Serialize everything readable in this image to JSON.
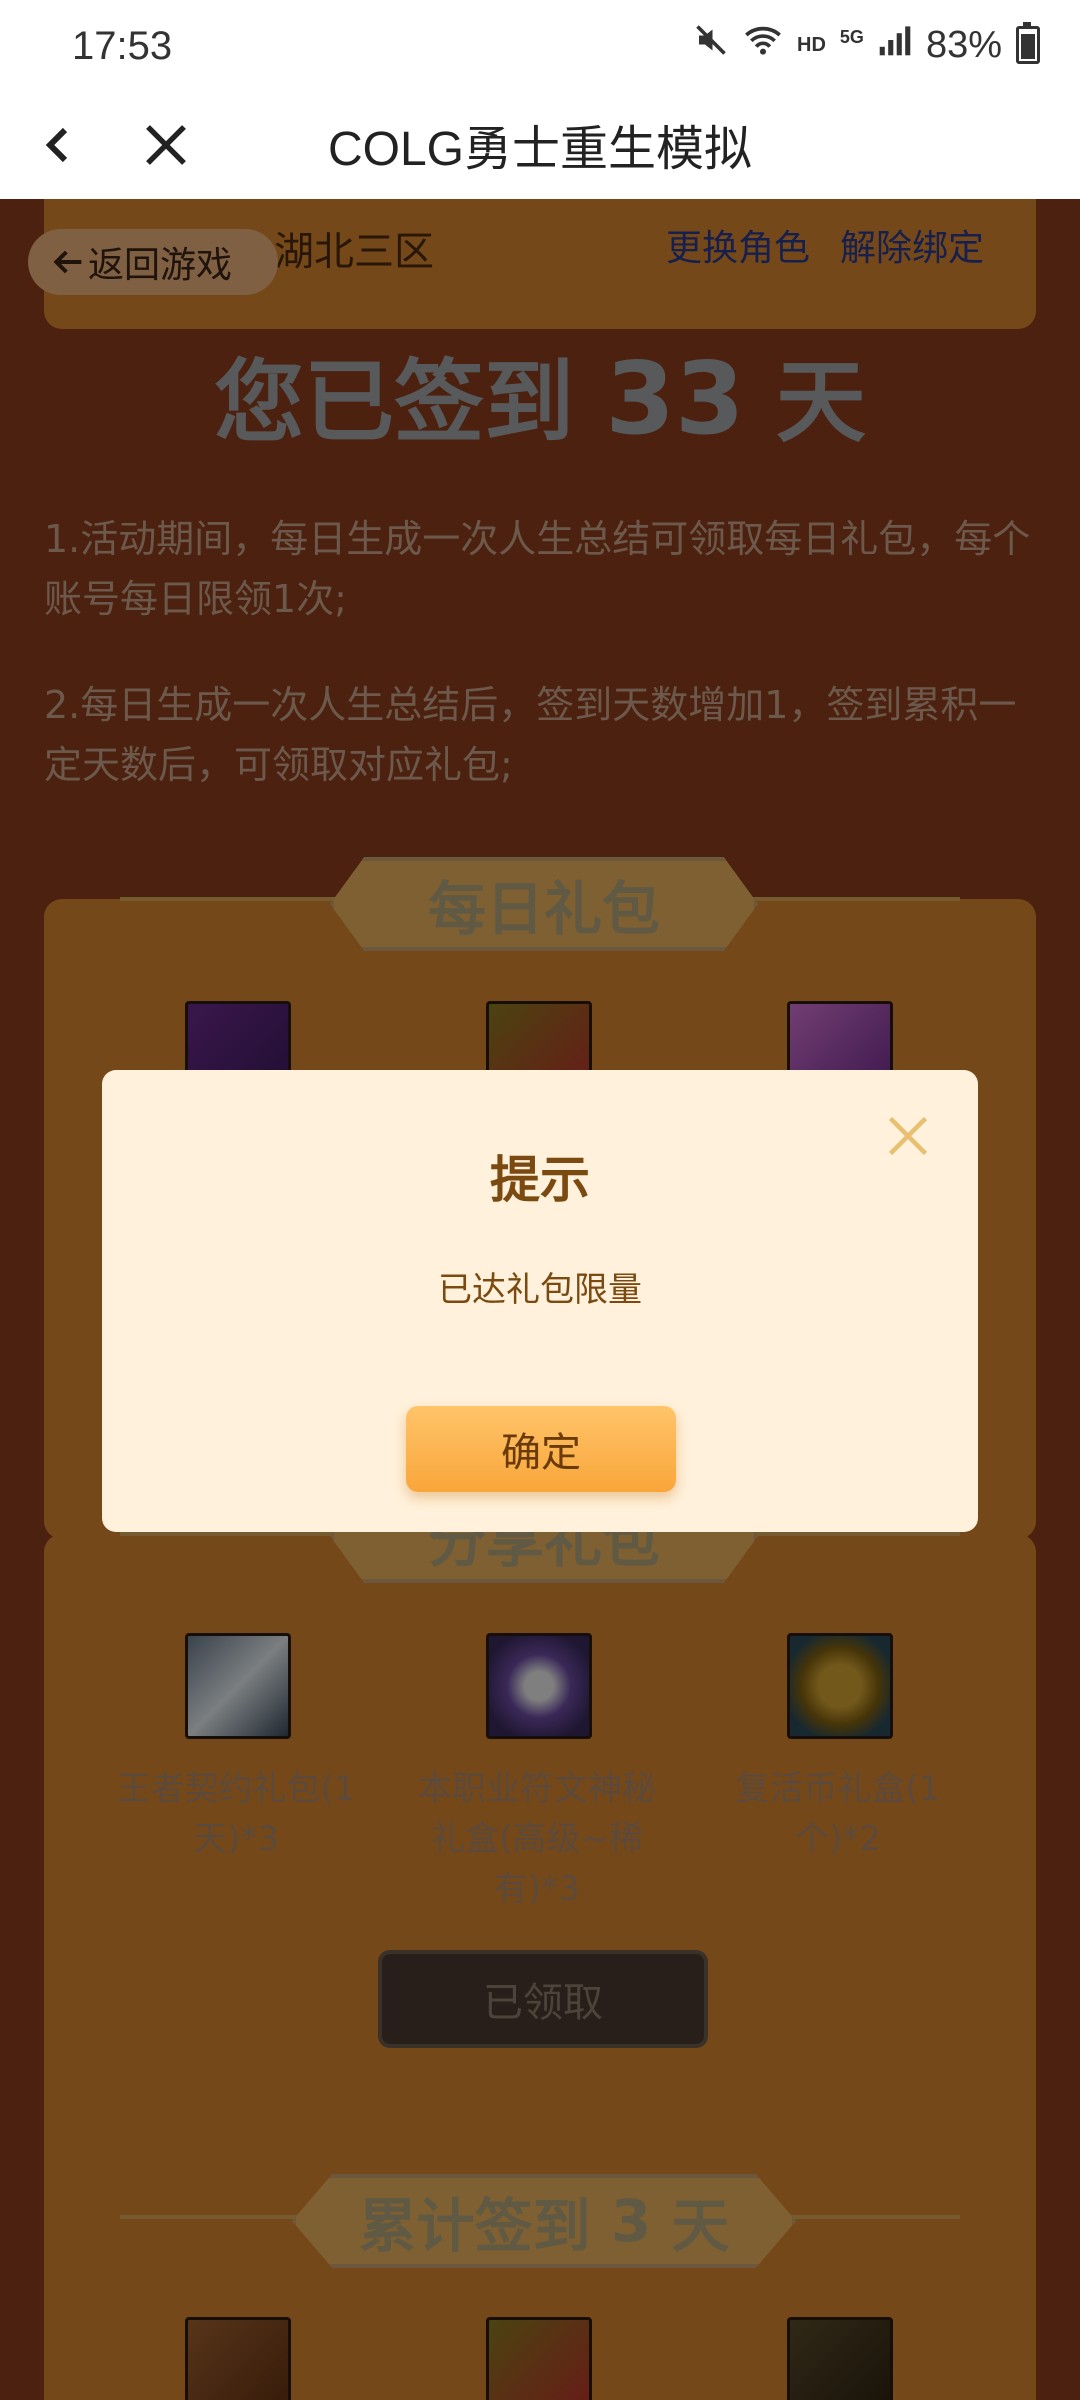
{
  "status_bar": {
    "time": "17:53",
    "hd": "HD",
    "network": "5G",
    "battery": "83%"
  },
  "header": {
    "title": "COLG勇士重生模拟"
  },
  "account": {
    "back_game": "返回游戏",
    "server": "湖北三区",
    "change_role": "更换角色",
    "unbind": "解除绑定"
  },
  "sign_in": {
    "prefix": "您已签到",
    "days": "33",
    "suffix": "天"
  },
  "rules": [
    "1.活动期间，每日生成一次人生总结可领取每日礼包，每个账号每日限领1次;",
    "2.每日生成一次人生总结后，签到天数增加1，签到累积一定天数后，可领取对应礼包;"
  ],
  "daily_pack": {
    "title": "每日礼包"
  },
  "weekly_pack": {
    "title": "分享礼包",
    "items": [
      "王者契约礼包(1天)*3",
      "本职业符文神秘礼盒(高级~稀有)*3",
      "复活币礼盒(1个)*2"
    ],
    "button": "已领取"
  },
  "total_pack": {
    "prefix": "累计签到",
    "days": "3",
    "suffix": "天"
  },
  "modal": {
    "title": "提示",
    "message": "已达礼包限量",
    "confirm": "确定"
  }
}
